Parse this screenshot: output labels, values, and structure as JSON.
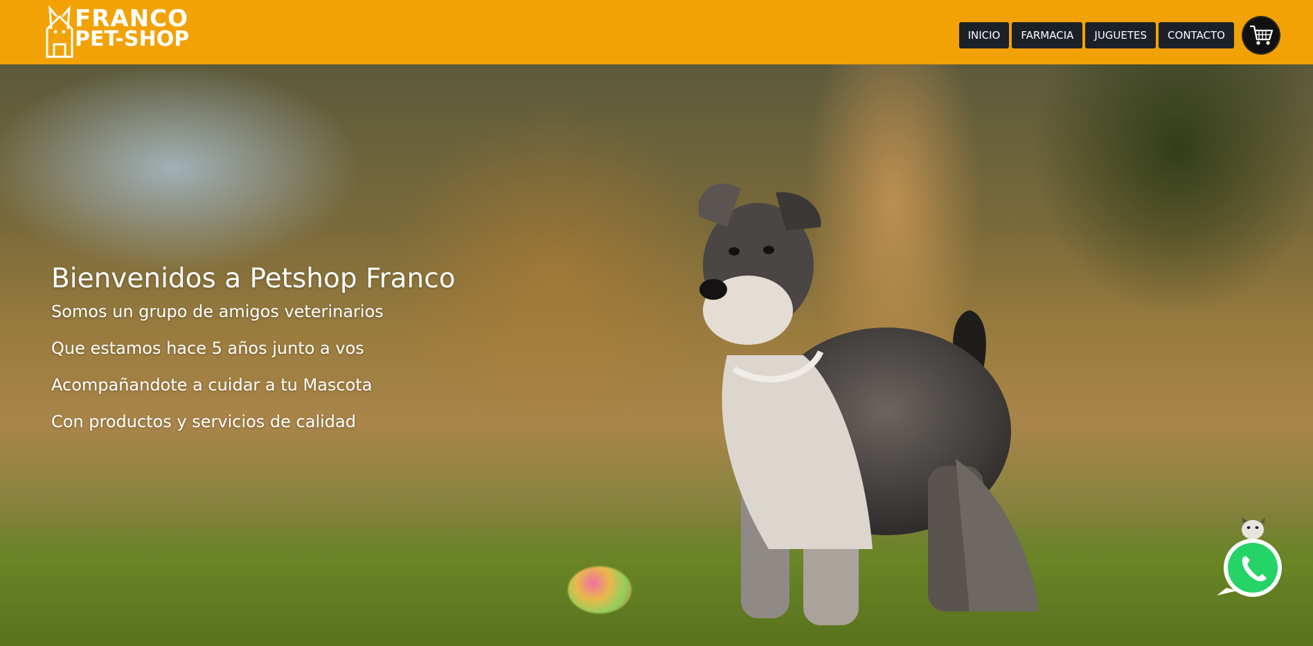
{
  "header": {
    "logo": {
      "line1": "FRANCO",
      "line2": "PET-SHOP",
      "icon": "house-dog-logo-icon"
    },
    "background_color": "#f2a205",
    "nav": [
      {
        "label": "INICIO"
      },
      {
        "label": "FARMACIA"
      },
      {
        "label": "JUGUETES"
      },
      {
        "label": "CONTACTO"
      }
    ],
    "cart_icon": "shopping-cart-icon"
  },
  "hero": {
    "title": "Bienvenidos a Petshop Franco",
    "lines": [
      "Somos un grupo de amigos veterinarios",
      "Que estamos hace 5 años junto a vos",
      "Acompañandote a cuidar a tu Mascota",
      "Con productos y servicios de calidad"
    ],
    "image": "schnauzer-dog-in-grass-photo"
  },
  "floating": {
    "whatsapp_icon": "whatsapp-icon"
  },
  "colors": {
    "nav_button": "#1c2128",
    "accent": "#f2a205",
    "whatsapp_green": "#25d366"
  }
}
